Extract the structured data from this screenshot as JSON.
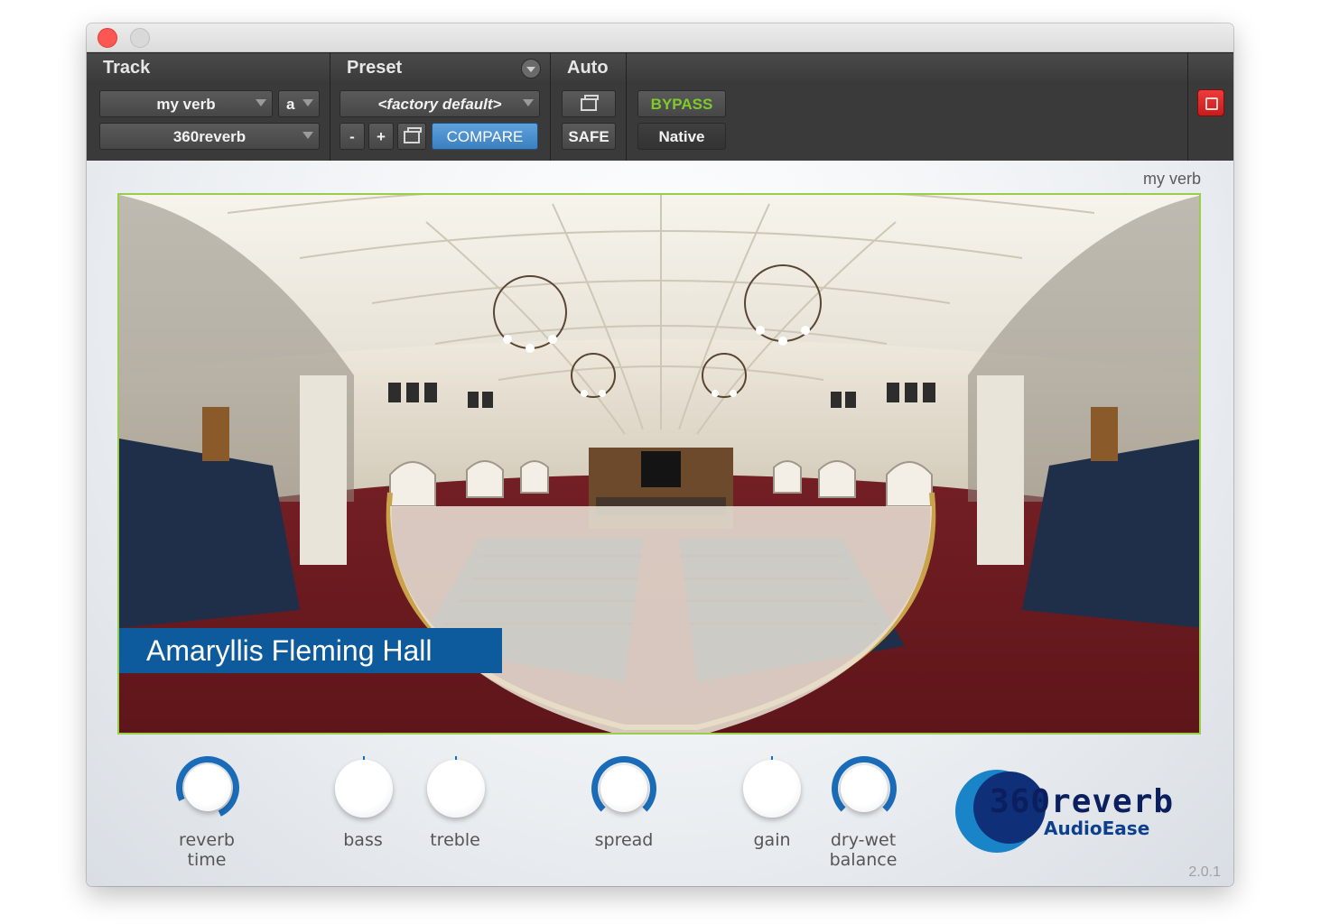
{
  "toolbar": {
    "track_header": "Track",
    "preset_header": "Preset",
    "auto_header": "Auto",
    "track_name": "my verb",
    "track_channel": "a",
    "plugin_insert": "360reverb",
    "preset_value": "<factory default>",
    "minus_label": "-",
    "plus_label": "+",
    "compare_label": "COMPARE",
    "safe_label": "SAFE",
    "bypass_label": "BYPASS",
    "native_label": "Native"
  },
  "plugin": {
    "instance_name": "my verb",
    "hall_name": "Amaryllis Fleming Hall",
    "version": "2.0.1",
    "knobs": [
      {
        "id": "reverb-time",
        "label_lines": [
          "reverb",
          "time"
        ],
        "style": "ring"
      },
      {
        "id": "bass",
        "label_lines": [
          "bass"
        ],
        "style": "plain"
      },
      {
        "id": "treble",
        "label_lines": [
          "treble"
        ],
        "style": "plain"
      },
      {
        "id": "spread",
        "label_lines": [
          "spread"
        ],
        "style": "ring"
      },
      {
        "id": "gain",
        "label_lines": [
          "gain"
        ],
        "style": "plain"
      },
      {
        "id": "dry-wet-balance",
        "label_lines": [
          "dry-wet",
          "balance"
        ],
        "style": "ring"
      }
    ],
    "logo": {
      "name": "360reverb",
      "company": "AudioEase"
    }
  },
  "colors": {
    "accent_blue": "#1b6cb8",
    "compare_blue": "#4a90d2",
    "bypass_green": "#7ecb2a",
    "close_red": "#fc5753",
    "hall_label_bg": "#0d5a9c",
    "carpet_red": "#7a2026",
    "seat_navy": "#1f2f4a"
  }
}
